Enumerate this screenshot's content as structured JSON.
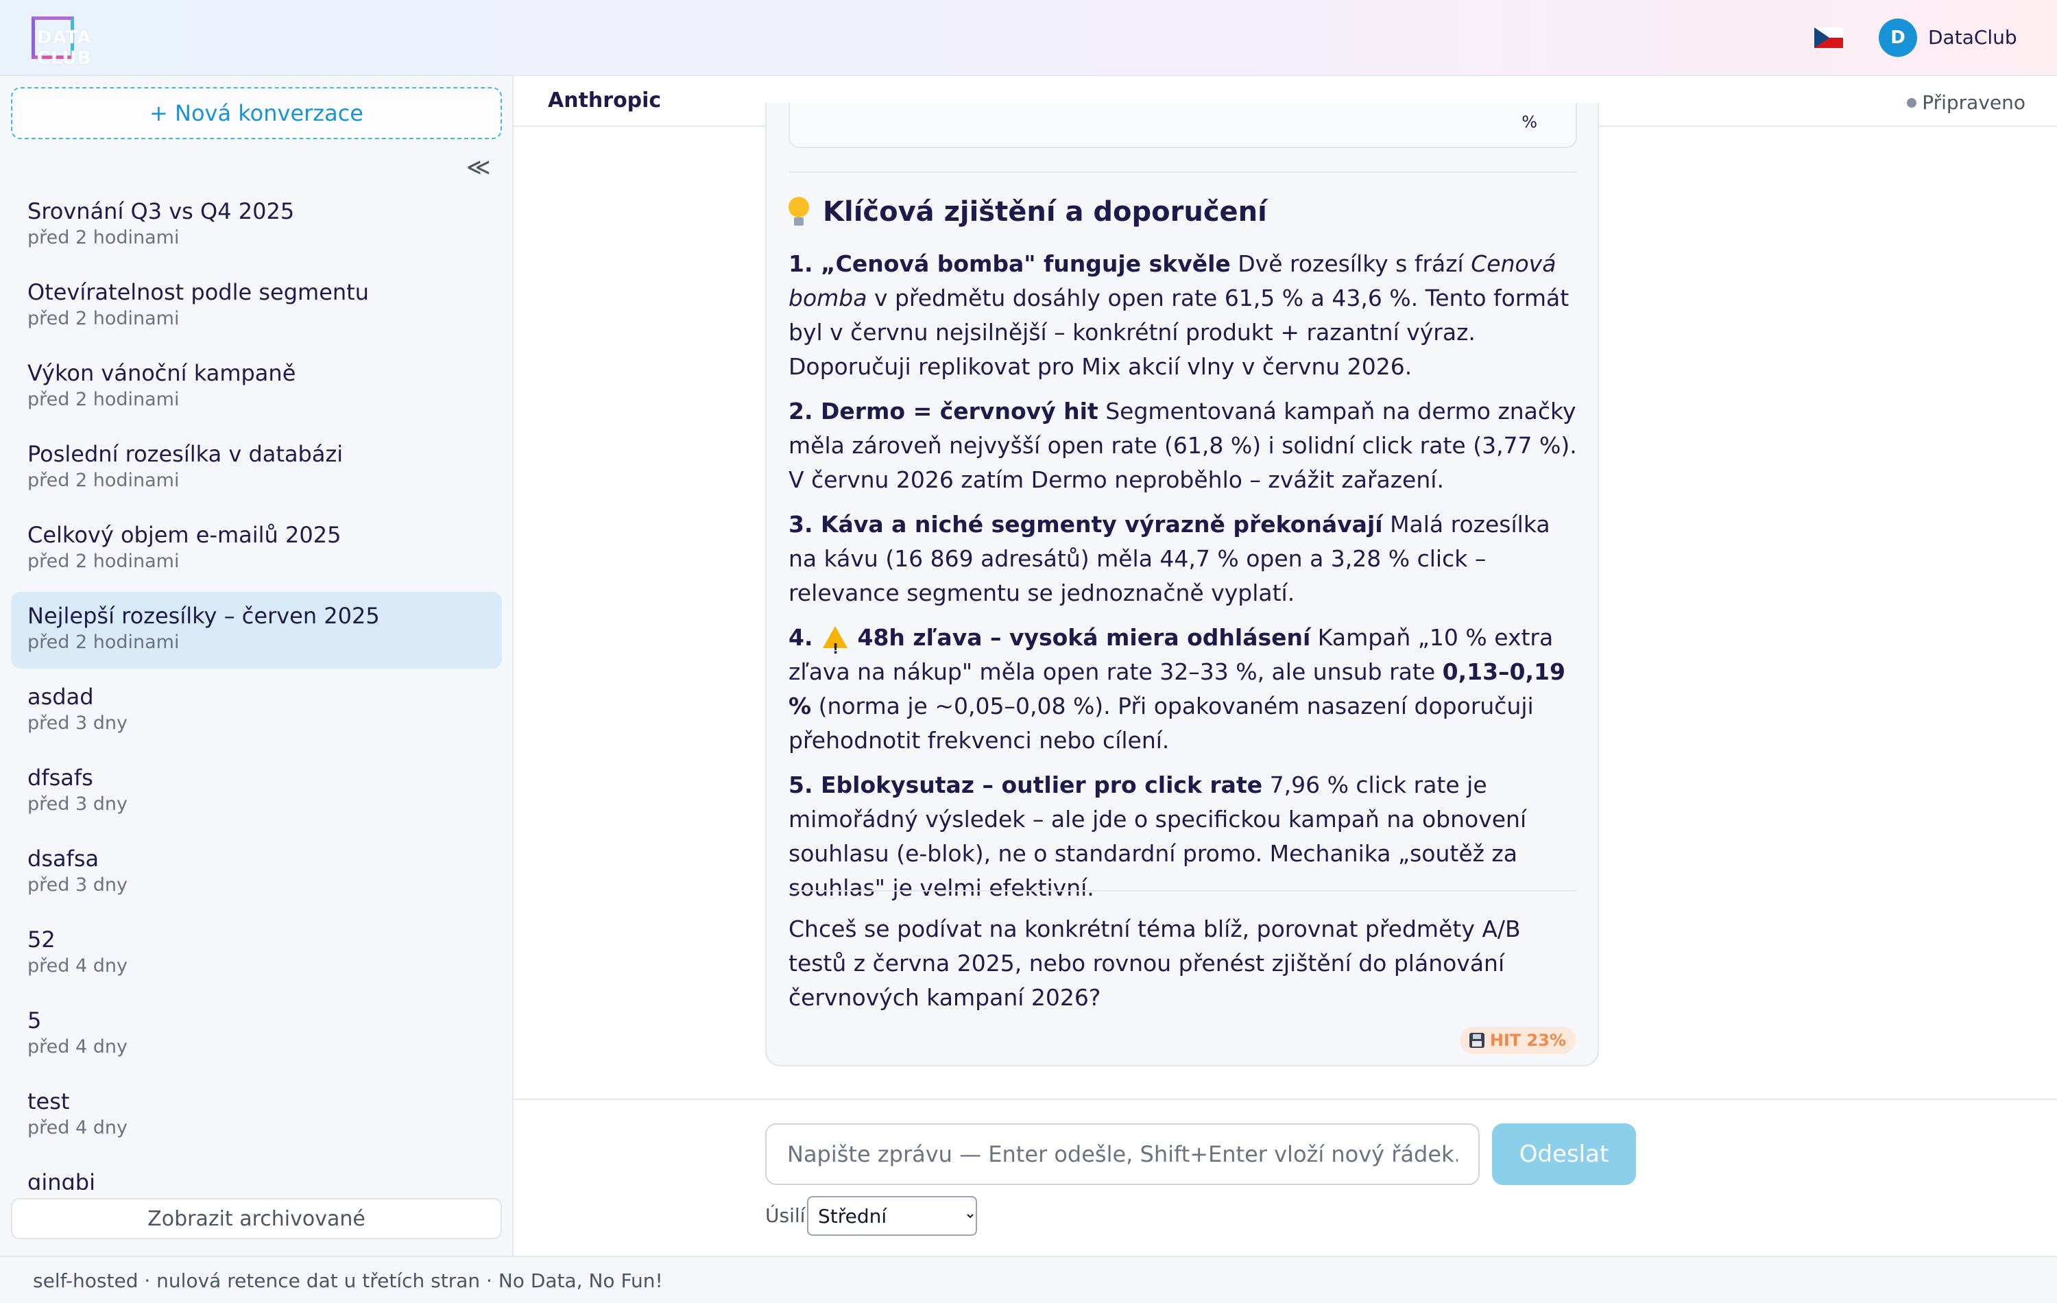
{
  "header": {
    "logo_text": "DATA CLUB",
    "language_flag": "czech-flag-icon",
    "user_initial": "D",
    "user_name": "DataClub"
  },
  "sidebar": {
    "new_conversation_label": "+ Nová konverzace",
    "collapse_glyph": "≪",
    "conversations": [
      {
        "title": "Srovnání Q3 vs Q4 2025",
        "time": "před 2 hodinami",
        "active": false
      },
      {
        "title": "Otevíratelnost podle segmentu",
        "time": "před 2 hodinami",
        "active": false
      },
      {
        "title": "Výkon vánoční kampaně",
        "time": "před 2 hodinami",
        "active": false
      },
      {
        "title": "Poslední rozesílka v databázi",
        "time": "před 2 hodinami",
        "active": false
      },
      {
        "title": "Celkový objem e-mailů 2025",
        "time": "před 2 hodinami",
        "active": false
      },
      {
        "title": "Nejlepší rozesílky – červen 2025",
        "time": "před 2 hodinami",
        "active": true
      },
      {
        "title": "asdad",
        "time": "před 3 dny",
        "active": false
      },
      {
        "title": "dfsafs",
        "time": "před 3 dny",
        "active": false
      },
      {
        "title": "dsafsa",
        "time": "před 3 dny",
        "active": false
      },
      {
        "title": "52",
        "time": "před 4 dny",
        "active": false
      },
      {
        "title": "5",
        "time": "před 4 dny",
        "active": false
      },
      {
        "title": "test",
        "time": "před 4 dny",
        "active": false
      },
      {
        "title": "gjngbi",
        "time": "",
        "active": false
      }
    ],
    "show_archived_label": "Zobrazit archivované"
  },
  "main": {
    "provider": "Anthropic",
    "status": "Připraveno",
    "message": {
      "prev_table_fragment": "%",
      "section_title": "Klíčová zjištění a doporučení",
      "findings": [
        {
          "bold": "1. „Cenová bomba\" funguje skvěle",
          "text_before_italic": " Dvě rozesílky s frází ",
          "italic": "Cenová bomba",
          "text_after_italic": " v předmětu dosáhly open rate 61,5 % a 43,6 %. Tento formát byl v červnu nejsilnější – konkrétní produkt + razantní výraz. Doporučuji replikovat pro Mix akcií vlny v červnu 2026."
        },
        {
          "bold": "2. Dermo = červnový hit",
          "text": " Segmentovaná kampaň na dermo značky měla zároveň nejvyšší open rate (61,8 %) i solidní click rate (3,77 %). V červnu 2026 zatím Dermo neproběhlo – zvážit zařazení."
        },
        {
          "bold": "3. Káva a niché segmenty výrazně překonávají",
          "text": " Malá rozesílka na kávu (16 869 adresátů) měla 44,7 % open a 3,28 % click – relevance segmentu se jednoznačně vyplatí."
        },
        {
          "bold_prefix": "4.",
          "icon": "warning-icon",
          "bold": "48h zľava – vysoká miera odhlásení",
          "text_before_bold2": " Kampaň „10 % extra zľava na nákup\" měla open rate 32–33 %, ale unsub rate ",
          "bold2": "0,13–0,19 %",
          "text_after_bold2": " (norma je ~0,05–0,08 %). Při opakovaném nasazení doporučuji přehodnotit frekvenci nebo cílení."
        },
        {
          "bold": "5. Eblokysutaz – outlier pro click rate",
          "text": " 7,96 % click rate je mimořádný výsledek – ale jde o specifickou kampaň na obnovení souhlasu (e-blok), ne o standardní promo. Mechanika „soutěž za souhlas\" je velmi efektivní."
        }
      ],
      "closing": "Chceš se podívat na konkrétní téma blíž, porovnat předměty A/B testů z června 2025, nebo rovnou přenést zjištění do plánování červnových kampaní 2026?",
      "cache_badge": "HIT 23%"
    }
  },
  "composer": {
    "placeholder": "Napište zprávu — Enter odešle, Shift+Enter vloží nový řádek.",
    "send_label": "Odeslat",
    "effort_label": "Úsilí",
    "effort_selected": "Střední"
  },
  "footer": {
    "text": "self-hosted · nulová retence dat u třetích stran · No Data, No Fun!"
  }
}
